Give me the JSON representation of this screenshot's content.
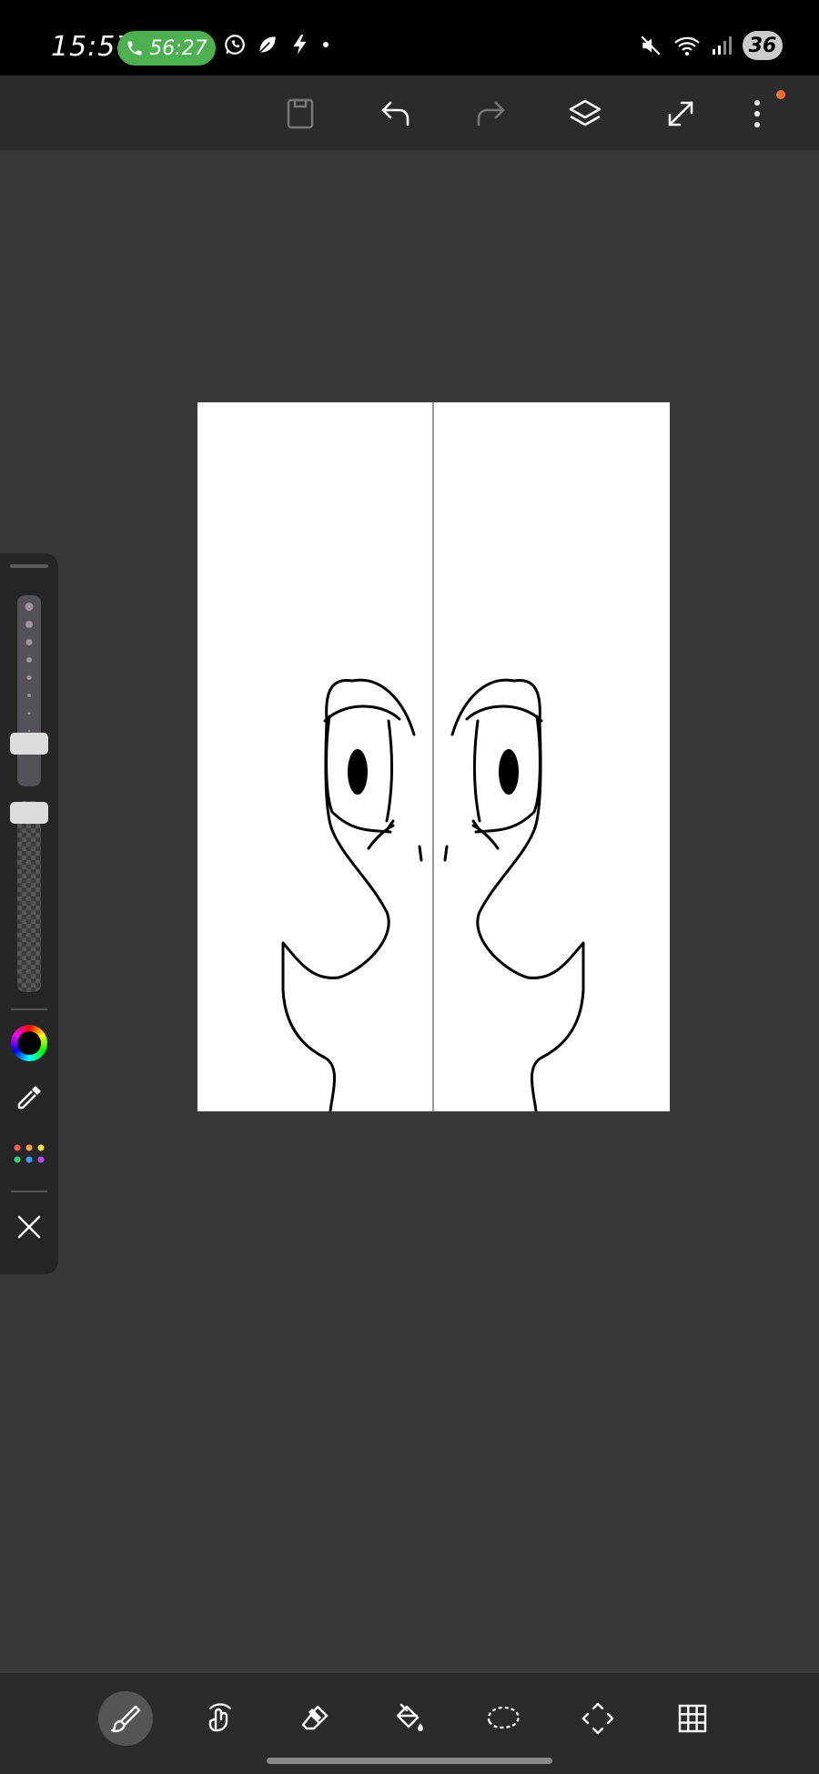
{
  "status_bar": {
    "time": "15:57",
    "call_timer": "56:27",
    "battery": "36"
  },
  "top_toolbar": {
    "buttons": [
      "save-icon",
      "undo-icon",
      "redo-icon",
      "layers-icon",
      "fullscreen-icon",
      "more-icon"
    ]
  },
  "canvas": {
    "background": "#ffffff",
    "symmetry_guide": "vertical"
  },
  "side_panel": {
    "brush_size_level": 0.78,
    "brush_opacity_level": 1.0,
    "tools": [
      "color-wheel-icon",
      "eyedropper-icon",
      "palette-icon",
      "close-icon"
    ]
  },
  "bottom_toolbar": {
    "tools": [
      "brush-icon",
      "smudge-icon",
      "eraser-icon",
      "fill-icon",
      "lasso-icon",
      "transform-icon",
      "grid-icon"
    ],
    "active_tool": "brush-icon"
  },
  "colors": {
    "accent_orange": "#ff6d2e",
    "call_green": "#4caf50"
  }
}
